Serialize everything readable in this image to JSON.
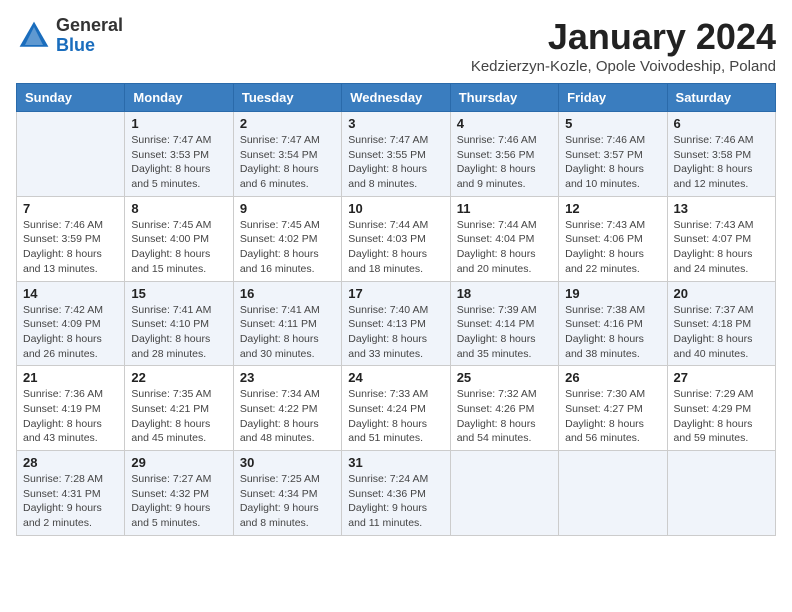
{
  "header": {
    "logo_general": "General",
    "logo_blue": "Blue",
    "title": "January 2024",
    "subtitle": "Kedzierzyn-Kozle, Opole Voivodeship, Poland"
  },
  "days_of_week": [
    "Sunday",
    "Monday",
    "Tuesday",
    "Wednesday",
    "Thursday",
    "Friday",
    "Saturday"
  ],
  "weeks": [
    [
      {
        "day": "",
        "info": ""
      },
      {
        "day": "1",
        "info": "Sunrise: 7:47 AM\nSunset: 3:53 PM\nDaylight: 8 hours\nand 5 minutes."
      },
      {
        "day": "2",
        "info": "Sunrise: 7:47 AM\nSunset: 3:54 PM\nDaylight: 8 hours\nand 6 minutes."
      },
      {
        "day": "3",
        "info": "Sunrise: 7:47 AM\nSunset: 3:55 PM\nDaylight: 8 hours\nand 8 minutes."
      },
      {
        "day": "4",
        "info": "Sunrise: 7:46 AM\nSunset: 3:56 PM\nDaylight: 8 hours\nand 9 minutes."
      },
      {
        "day": "5",
        "info": "Sunrise: 7:46 AM\nSunset: 3:57 PM\nDaylight: 8 hours\nand 10 minutes."
      },
      {
        "day": "6",
        "info": "Sunrise: 7:46 AM\nSunset: 3:58 PM\nDaylight: 8 hours\nand 12 minutes."
      }
    ],
    [
      {
        "day": "7",
        "info": "Sunrise: 7:46 AM\nSunset: 3:59 PM\nDaylight: 8 hours\nand 13 minutes."
      },
      {
        "day": "8",
        "info": "Sunrise: 7:45 AM\nSunset: 4:00 PM\nDaylight: 8 hours\nand 15 minutes."
      },
      {
        "day": "9",
        "info": "Sunrise: 7:45 AM\nSunset: 4:02 PM\nDaylight: 8 hours\nand 16 minutes."
      },
      {
        "day": "10",
        "info": "Sunrise: 7:44 AM\nSunset: 4:03 PM\nDaylight: 8 hours\nand 18 minutes."
      },
      {
        "day": "11",
        "info": "Sunrise: 7:44 AM\nSunset: 4:04 PM\nDaylight: 8 hours\nand 20 minutes."
      },
      {
        "day": "12",
        "info": "Sunrise: 7:43 AM\nSunset: 4:06 PM\nDaylight: 8 hours\nand 22 minutes."
      },
      {
        "day": "13",
        "info": "Sunrise: 7:43 AM\nSunset: 4:07 PM\nDaylight: 8 hours\nand 24 minutes."
      }
    ],
    [
      {
        "day": "14",
        "info": "Sunrise: 7:42 AM\nSunset: 4:09 PM\nDaylight: 8 hours\nand 26 minutes."
      },
      {
        "day": "15",
        "info": "Sunrise: 7:41 AM\nSunset: 4:10 PM\nDaylight: 8 hours\nand 28 minutes."
      },
      {
        "day": "16",
        "info": "Sunrise: 7:41 AM\nSunset: 4:11 PM\nDaylight: 8 hours\nand 30 minutes."
      },
      {
        "day": "17",
        "info": "Sunrise: 7:40 AM\nSunset: 4:13 PM\nDaylight: 8 hours\nand 33 minutes."
      },
      {
        "day": "18",
        "info": "Sunrise: 7:39 AM\nSunset: 4:14 PM\nDaylight: 8 hours\nand 35 minutes."
      },
      {
        "day": "19",
        "info": "Sunrise: 7:38 AM\nSunset: 4:16 PM\nDaylight: 8 hours\nand 38 minutes."
      },
      {
        "day": "20",
        "info": "Sunrise: 7:37 AM\nSunset: 4:18 PM\nDaylight: 8 hours\nand 40 minutes."
      }
    ],
    [
      {
        "day": "21",
        "info": "Sunrise: 7:36 AM\nSunset: 4:19 PM\nDaylight: 8 hours\nand 43 minutes."
      },
      {
        "day": "22",
        "info": "Sunrise: 7:35 AM\nSunset: 4:21 PM\nDaylight: 8 hours\nand 45 minutes."
      },
      {
        "day": "23",
        "info": "Sunrise: 7:34 AM\nSunset: 4:22 PM\nDaylight: 8 hours\nand 48 minutes."
      },
      {
        "day": "24",
        "info": "Sunrise: 7:33 AM\nSunset: 4:24 PM\nDaylight: 8 hours\nand 51 minutes."
      },
      {
        "day": "25",
        "info": "Sunrise: 7:32 AM\nSunset: 4:26 PM\nDaylight: 8 hours\nand 54 minutes."
      },
      {
        "day": "26",
        "info": "Sunrise: 7:30 AM\nSunset: 4:27 PM\nDaylight: 8 hours\nand 56 minutes."
      },
      {
        "day": "27",
        "info": "Sunrise: 7:29 AM\nSunset: 4:29 PM\nDaylight: 8 hours\nand 59 minutes."
      }
    ],
    [
      {
        "day": "28",
        "info": "Sunrise: 7:28 AM\nSunset: 4:31 PM\nDaylight: 9 hours\nand 2 minutes."
      },
      {
        "day": "29",
        "info": "Sunrise: 7:27 AM\nSunset: 4:32 PM\nDaylight: 9 hours\nand 5 minutes."
      },
      {
        "day": "30",
        "info": "Sunrise: 7:25 AM\nSunset: 4:34 PM\nDaylight: 9 hours\nand 8 minutes."
      },
      {
        "day": "31",
        "info": "Sunrise: 7:24 AM\nSunset: 4:36 PM\nDaylight: 9 hours\nand 11 minutes."
      },
      {
        "day": "",
        "info": ""
      },
      {
        "day": "",
        "info": ""
      },
      {
        "day": "",
        "info": ""
      }
    ]
  ]
}
